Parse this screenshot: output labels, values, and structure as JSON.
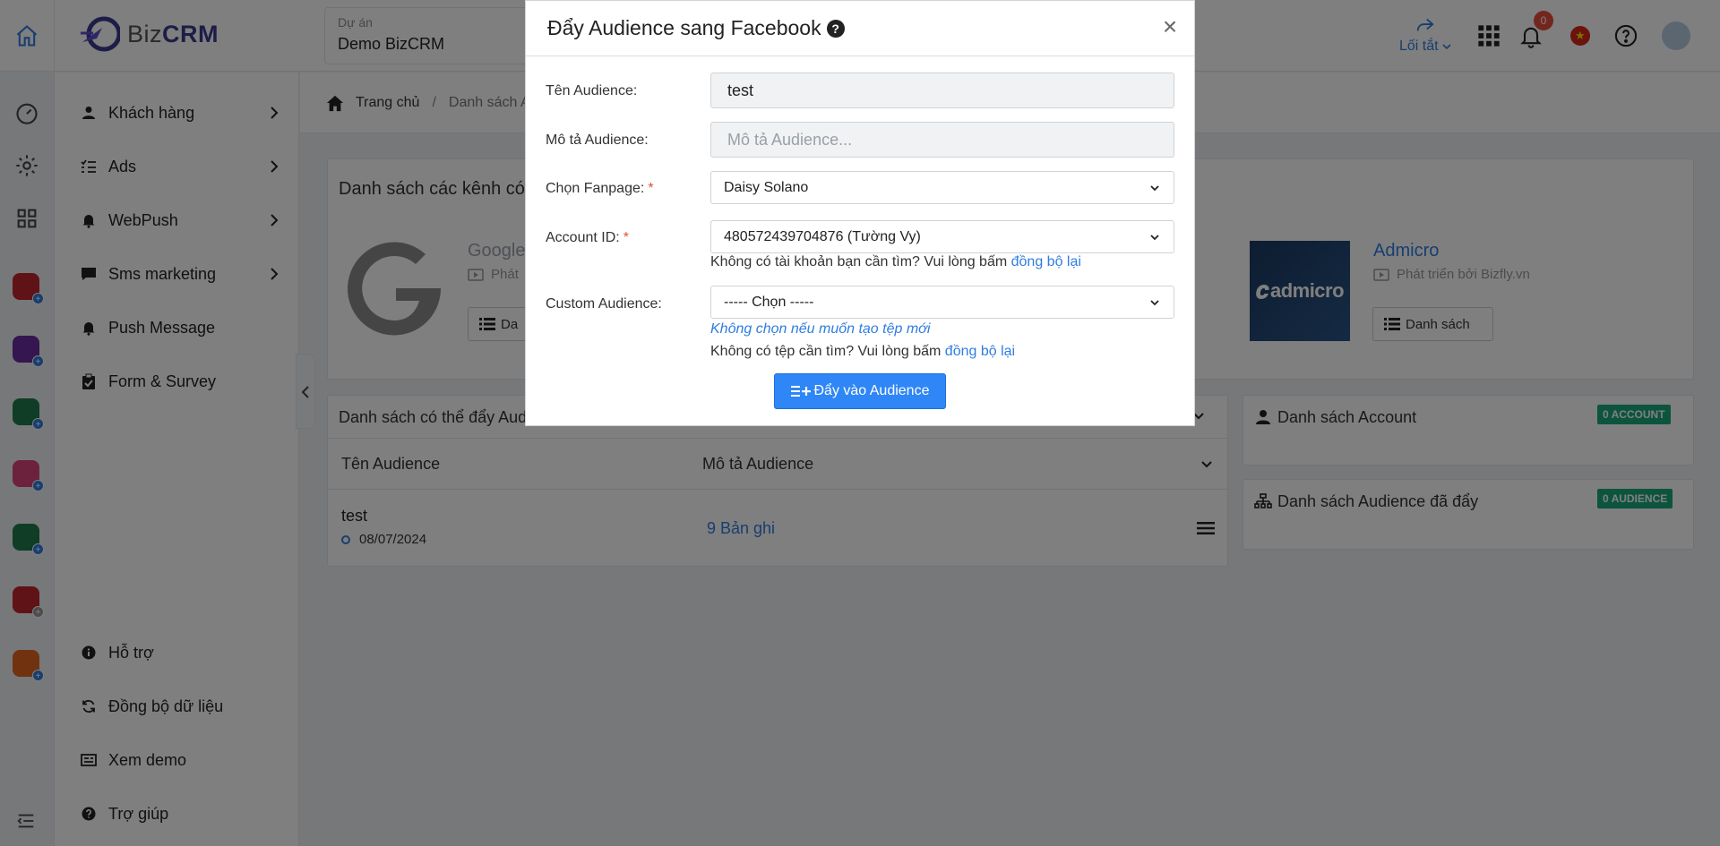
{
  "header": {
    "logo_text_a": "Biz",
    "logo_text_b": "CRM",
    "project_label": "Dự án",
    "project_value": "Demo BizCRM",
    "shortcut_label": "Lối tắt",
    "notification_count": "0"
  },
  "sidebar": {
    "items": [
      {
        "label": "Khách hàng"
      },
      {
        "label": "Ads"
      },
      {
        "label": "WebPush"
      },
      {
        "label": "Sms marketing"
      },
      {
        "label": "Push Message"
      },
      {
        "label": "Form & Survey"
      }
    ],
    "bottom_items": [
      {
        "label": "Hỗ trợ"
      },
      {
        "label": "Đồng bộ dữ liệu"
      },
      {
        "label": "Xem demo"
      },
      {
        "label": "Trợ giúp"
      }
    ]
  },
  "breadcrumb": {
    "home": "Trang chủ",
    "separator": "/",
    "current": "Danh sách A"
  },
  "channels": {
    "title": "Danh sách các kênh có",
    "google_name": "Google",
    "google_sub": "Phát",
    "google_btn": "Da",
    "admicro_logo": "admicro",
    "admicro_name": "Admicro",
    "admicro_sub": "Phát triển bởi Bizfly.vn",
    "admicro_btn": "Danh sách"
  },
  "audience_table": {
    "title": "Danh sách có thể đẩy Aud",
    "col_name": "Tên Audience",
    "col_desc": "Mô tả Audience",
    "rows": [
      {
        "name": "test",
        "date": "08/07/2024",
        "records": "9 Bản ghi"
      }
    ]
  },
  "account_panel": {
    "title": "Danh sách Account",
    "badge": "0 ACCOUNT"
  },
  "pushed_panel": {
    "title": "Danh sách Audience đã đẩy",
    "badge": "0 AUDIENCE"
  },
  "modal": {
    "title": "Đẩy Audience sang Facebook",
    "help_glyph": "?",
    "close_glyph": "×",
    "name_label": "Tên Audience:",
    "name_value": "test",
    "desc_label": "Mô tả Audience:",
    "desc_placeholder": "Mô tả Audience...",
    "fanpage_label": "Chọn Fanpage:",
    "fanpage_value": "Daisy Solano",
    "account_label": "Account ID:",
    "account_value": "480572439704876 (Tường Vy)",
    "account_help": "Không có tài khoản bạn cần tìm? Vui lòng bấm ",
    "sync_link": "đồng bộ lại",
    "custom_label": "Custom Audience:",
    "custom_value": "----- Chọn -----",
    "custom_hint": "Không chọn nếu muốn tạo tệp mới",
    "custom_help": "Không có tệp cần tìm? Vui lòng bấm ",
    "submit_label": "Đẩy vào Audience",
    "required_mark": "*"
  },
  "colors": {
    "accent": "#2f7de1",
    "badge_green": "#1aa97c",
    "danger": "#e74c3c"
  }
}
